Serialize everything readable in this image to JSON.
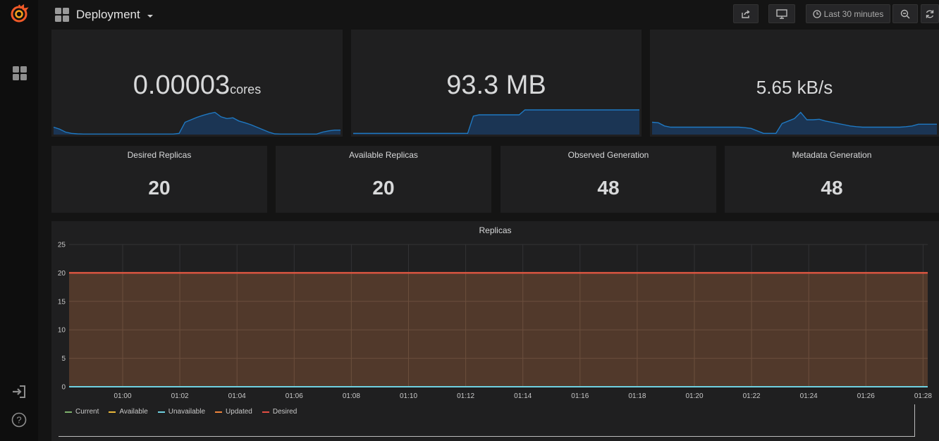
{
  "header": {
    "dashboard_title": "Deployment",
    "time_range": "Last 30 minutes"
  },
  "sidebar": {
    "icons": [
      "grafana-logo-icon",
      "dashboards-icon",
      "sign-in-icon",
      "help-icon"
    ],
    "help_glyph": "?"
  },
  "top_stats": [
    {
      "value": "0.00003",
      "unit": "cores",
      "sparkline": [
        0.3,
        0.22,
        0.1,
        0.05,
        0.03,
        0.02,
        0.02,
        0.02,
        0.02,
        0.02,
        0.02,
        0.02,
        0.02,
        0.02,
        0.02,
        0.02,
        0.02,
        0.02,
        0.02,
        0.02,
        0.02,
        0.05,
        0.5,
        0.6,
        0.7,
        0.78,
        0.85,
        0.9,
        0.72,
        0.65,
        0.68,
        0.55,
        0.48,
        0.4,
        0.3,
        0.2,
        0.1,
        0.03,
        0.02,
        0.02,
        0.02,
        0.02,
        0.02,
        0.02,
        0.02,
        0.1,
        0.15,
        0.18,
        0.18
      ]
    },
    {
      "value": "93.3 MB",
      "unit": "",
      "sparkline": [
        0.05,
        0.05,
        0.05,
        0.05,
        0.05,
        0.05,
        0.05,
        0.05,
        0.05,
        0.05,
        0.05,
        0.05,
        0.05,
        0.05,
        0.05,
        0.05,
        0.05,
        0.05,
        0.05,
        0.05,
        0.05,
        0.75,
        0.8,
        0.8,
        0.8,
        0.8,
        0.8,
        0.8,
        0.8,
        0.8,
        1.0,
        1.0,
        1.0,
        1.0,
        1.0,
        1.0,
        1.0,
        1.0,
        1.0,
        1.0,
        1.0,
        1.0,
        1.0,
        1.0,
        1.0,
        1.0,
        1.0,
        1.0,
        1.0,
        1.0,
        1.0
      ]
    },
    {
      "value": "5.65 kB/s",
      "unit": "",
      "sparkline": [
        0.5,
        0.48,
        0.35,
        0.3,
        0.3,
        0.3,
        0.3,
        0.3,
        0.3,
        0.3,
        0.3,
        0.3,
        0.3,
        0.3,
        0.3,
        0.28,
        0.25,
        0.15,
        0.05,
        0.05,
        0.05,
        0.45,
        0.55,
        0.65,
        0.9,
        0.6,
        0.6,
        0.62,
        0.55,
        0.5,
        0.45,
        0.4,
        0.35,
        0.32,
        0.3,
        0.3,
        0.3,
        0.3,
        0.3,
        0.3,
        0.3,
        0.32,
        0.35,
        0.42,
        0.42,
        0.42,
        0.42
      ]
    }
  ],
  "singlestats": [
    {
      "title": "Desired Replicas",
      "value": "20"
    },
    {
      "title": "Available Replicas",
      "value": "20"
    },
    {
      "title": "Observed Generation",
      "value": "48"
    },
    {
      "title": "Metadata Generation",
      "value": "48"
    }
  ],
  "replicas_panel": {
    "title": "Replicas"
  },
  "chart_data": {
    "type": "area",
    "title": "Replicas",
    "x": [
      "01:00",
      "01:02",
      "01:04",
      "01:06",
      "01:08",
      "01:10",
      "01:12",
      "01:14",
      "01:16",
      "01:18",
      "01:20",
      "01:22",
      "01:24",
      "01:26",
      "01:28"
    ],
    "y_ticks": [
      0,
      5,
      10,
      15,
      20,
      25
    ],
    "ylim": [
      0,
      25
    ],
    "grid": true,
    "legend_position": "bottom-left",
    "series": [
      {
        "name": "Current",
        "color": "#7eb26d",
        "value": 20
      },
      {
        "name": "Available",
        "color": "#eab839",
        "value": 20
      },
      {
        "name": "Unavailable",
        "color": "#6ed0e0",
        "value": 0
      },
      {
        "name": "Updated",
        "color": "#ef843c",
        "value": 20
      },
      {
        "name": "Desired",
        "color": "#e24d42",
        "value": 20
      }
    ]
  },
  "colors": {
    "panel_bg": "#1f1f20",
    "spark_line": "#1f78c1",
    "area_fill": "#5a3e2e"
  }
}
